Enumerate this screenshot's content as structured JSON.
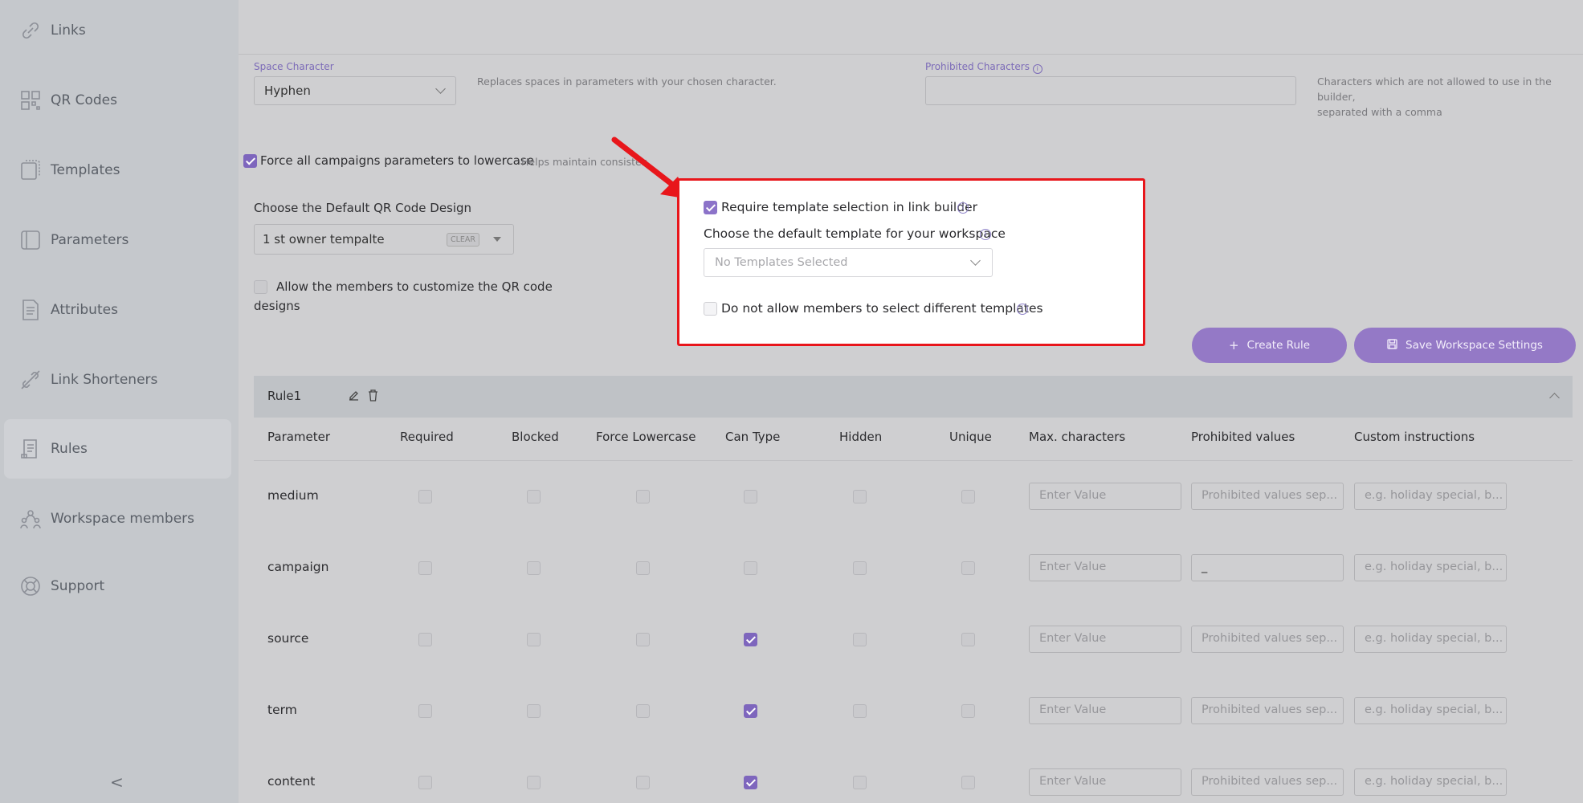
{
  "sidebar": {
    "items": [
      {
        "label": "Links",
        "icon": "link-icon"
      },
      {
        "label": "QR Codes",
        "icon": "qr-code-icon"
      },
      {
        "label": "Templates",
        "icon": "template-icon"
      },
      {
        "label": "Parameters",
        "icon": "parameters-icon"
      },
      {
        "label": "Attributes",
        "icon": "attributes-icon"
      },
      {
        "label": "Link Shorteners",
        "icon": "link-shortener-icon"
      },
      {
        "label": "Rules",
        "icon": "rules-icon"
      },
      {
        "label": "Workspace members",
        "icon": "members-icon"
      },
      {
        "label": "Support",
        "icon": "support-icon"
      }
    ],
    "active": "Rules",
    "collapse_glyph": "<"
  },
  "settings": {
    "space_character": {
      "label": "Space Character",
      "value": "Hyphen",
      "help": "Replaces spaces in parameters with your chosen character."
    },
    "prohibited_characters": {
      "label": "Prohibited Characters",
      "value": "",
      "help_line1": "Characters which are not allowed to use in the builder,",
      "help_line2": "separated with a comma"
    },
    "force_lowercase": {
      "label": "Force all campaigns parameters to lowercase",
      "checked": true,
      "help": "Helps maintain consisten"
    },
    "qr_design": {
      "label": "Choose the Default QR Code Design",
      "value": "1 st owner tempalte",
      "clear": "CLEAR"
    },
    "allow_customize": {
      "label_line1": "Allow the members to customize the QR code",
      "label_line2": "designs",
      "checked": false
    }
  },
  "template_panel": {
    "require_label": "Require template selection in link builder",
    "require_checked": true,
    "default_label": "Choose the default template for your workspace",
    "default_placeholder": "No Templates Selected",
    "disallow_label": "Do not allow members to select different templates",
    "disallow_checked": false
  },
  "buttons": {
    "create_rule": "Create Rule",
    "save_settings": "Save Workspace Settings"
  },
  "rule": {
    "name": "Rule1",
    "columns": [
      "Parameter",
      "Required",
      "Blocked",
      "Force Lowercase",
      "Can Type",
      "Hidden",
      "Unique",
      "Max. characters",
      "Prohibited values",
      "Custom instructions"
    ],
    "rows": [
      {
        "param": "medium",
        "can_type": false,
        "max": "Enter Value",
        "prohibited": "Prohibited values sep...",
        "prohibited_filled": false,
        "custom": "e.g. holiday special, b..."
      },
      {
        "param": "campaign",
        "can_type": false,
        "max": "Enter Value",
        "prohibited": "_",
        "prohibited_filled": true,
        "custom": "e.g. holiday special, b..."
      },
      {
        "param": "source",
        "can_type": true,
        "max": "Enter Value",
        "prohibited": "Prohibited values sep...",
        "prohibited_filled": false,
        "custom": "e.g. holiday special, b..."
      },
      {
        "param": "term",
        "can_type": true,
        "max": "Enter Value",
        "prohibited": "Prohibited values sep...",
        "prohibited_filled": false,
        "custom": "e.g. holiday special, b..."
      },
      {
        "param": "content",
        "can_type": true,
        "max": "Enter Value",
        "prohibited": "Prohibited values sep...",
        "prohibited_filled": false,
        "custom": "e.g. holiday special, b..."
      }
    ]
  },
  "colors": {
    "accent": "#9479c6",
    "highlight_border": "#e8161b",
    "arrow": "#e8161b"
  }
}
